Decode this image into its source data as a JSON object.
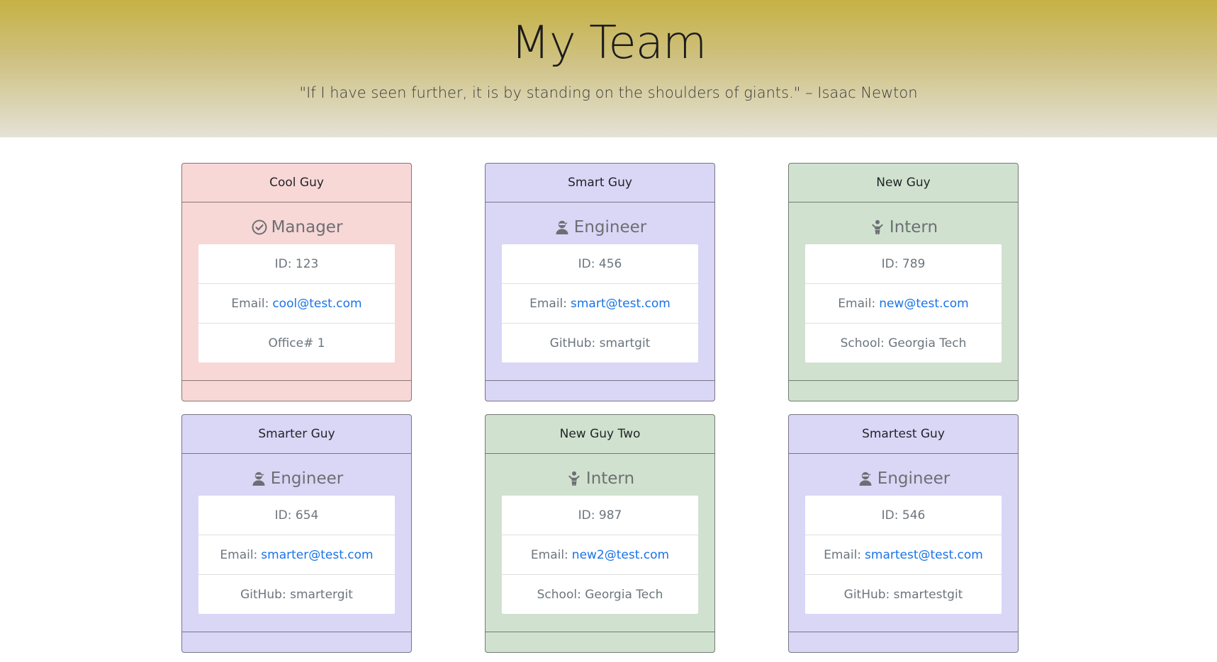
{
  "header": {
    "title": "My Team",
    "quote": "\"If I have seen further, it is by standing on the shoulders of giants.\" – Isaac Newton"
  },
  "colors": {
    "manager": "#f8d7d7",
    "engineer": "#dad6f6",
    "intern": "#d0e2cf",
    "link": "#1a73e8"
  },
  "cards": [
    {
      "name": "Cool Guy",
      "role": "Manager",
      "icon": "check-circle-icon",
      "id_label": "ID: 123",
      "email_label": "Email:",
      "email": "cool@test.com",
      "extra": "Office# 1"
    },
    {
      "name": "Smart Guy",
      "role": "Engineer",
      "icon": "user-ninja-icon",
      "id_label": "ID: 456",
      "email_label": "Email:",
      "email": "smart@test.com",
      "extra": "GitHub: smartgit"
    },
    {
      "name": "New Guy",
      "role": "Intern",
      "icon": "child-icon",
      "id_label": "ID: 789",
      "email_label": "Email:",
      "email": "new@test.com",
      "extra": "School: Georgia Tech"
    },
    {
      "name": "Smarter Guy",
      "role": "Engineer",
      "icon": "user-ninja-icon",
      "id_label": "ID: 654",
      "email_label": "Email:",
      "email": "smarter@test.com",
      "extra": "GitHub: smartergit"
    },
    {
      "name": "New Guy Two",
      "role": "Intern",
      "icon": "child-icon",
      "id_label": "ID: 987",
      "email_label": "Email:",
      "email": "new2@test.com",
      "extra": "School: Georgia Tech"
    },
    {
      "name": "Smartest Guy",
      "role": "Engineer",
      "icon": "user-ninja-icon",
      "id_label": "ID: 546",
      "email_label": "Email:",
      "email": "smartest@test.com",
      "extra": "GitHub: smartestgit"
    }
  ]
}
